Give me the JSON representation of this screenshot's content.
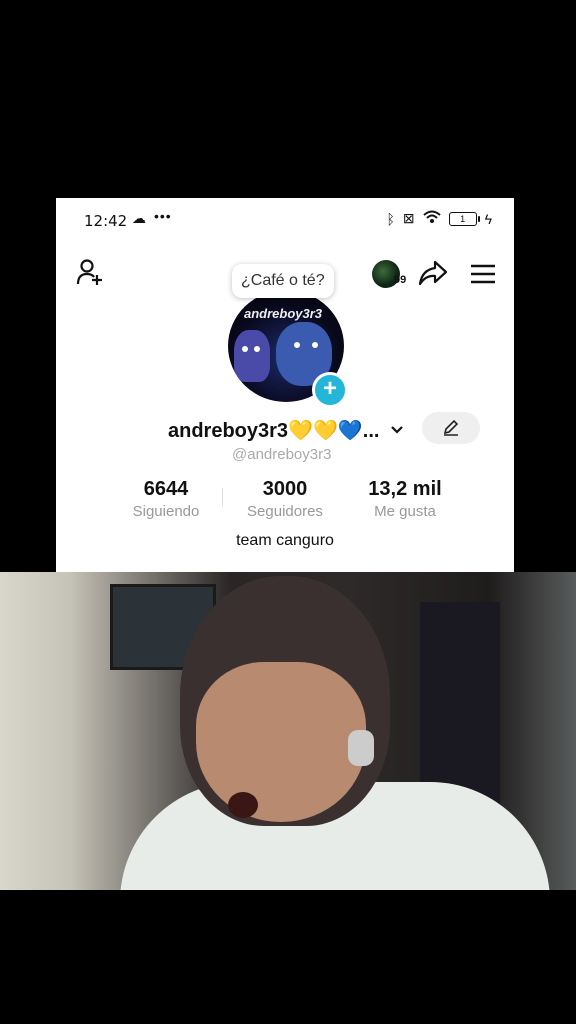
{
  "status_bar": {
    "time": "12:42",
    "dots": "•••",
    "battery": "1"
  },
  "header": {
    "notification_count": "99",
    "bubble_text": "¿Café o té?"
  },
  "avatar": {
    "caption": "andreboy3r3"
  },
  "profile": {
    "display_name": "andreboy3r3💛💛💙...",
    "handle": "@andreboy3r3",
    "bio": "team canguro"
  },
  "stats": [
    {
      "value": "6644",
      "label": "Siguiendo"
    },
    {
      "value": "3000",
      "label": "Seguidores"
    },
    {
      "value": "13,2 mil",
      "label": "Me gusta"
    }
  ],
  "colors": {
    "accent": "#23b6d8",
    "background": "#000000"
  }
}
